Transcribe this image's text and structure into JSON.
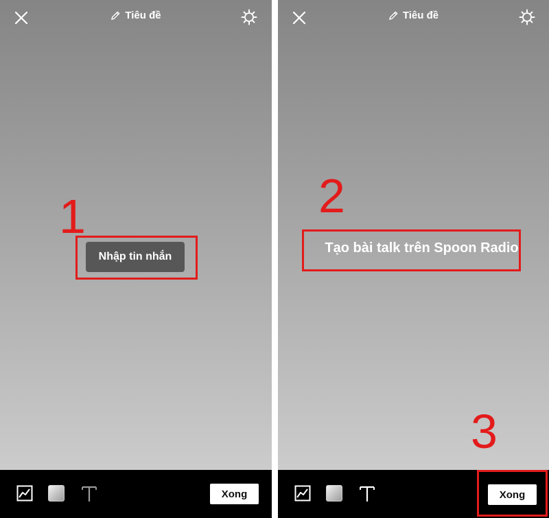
{
  "screens": [
    {
      "title": "Tiêu đề",
      "message_button_label": "Nhập tin nhắn",
      "done_label": "Xong",
      "icons": [
        "close-icon",
        "pencil-icon",
        "gear-icon",
        "chart-icon",
        "gradient-icon",
        "text-icon"
      ]
    },
    {
      "title": "Tiêu đề",
      "message_text": "Tạo bài talk trên Spoon Radio",
      "done_label": "Xong",
      "icons": [
        "close-icon",
        "pencil-icon",
        "gear-icon",
        "chart-icon",
        "gradient-icon",
        "text-icon"
      ]
    }
  ],
  "annotations": {
    "step1": "1",
    "step2": "2",
    "step3": "3",
    "highlight_color": "#e31b1b"
  },
  "colors": {
    "background_top": "#858585",
    "background_bottom": "#d3d3d3",
    "toolbar": "#000000",
    "message_button": "#575757"
  }
}
